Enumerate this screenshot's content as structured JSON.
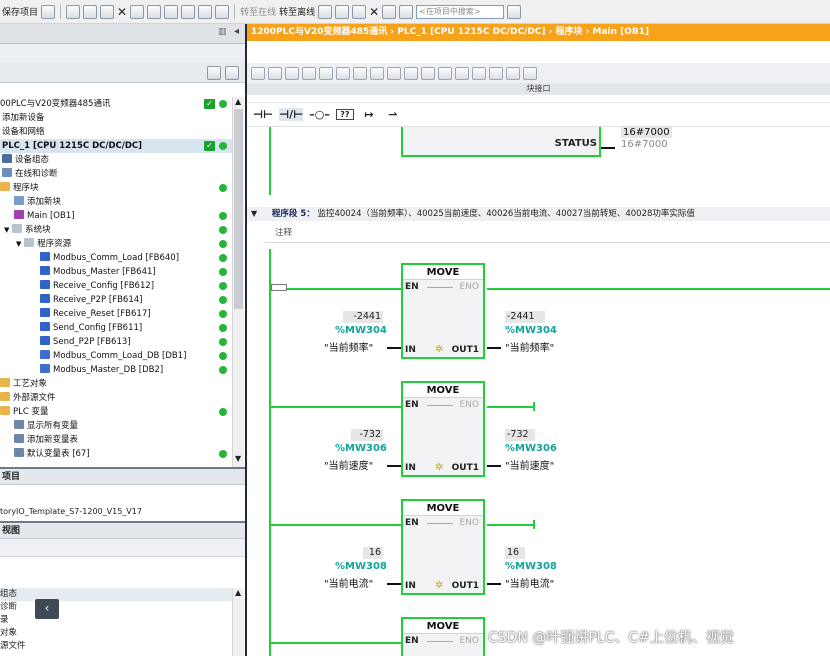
{
  "toolbar": {
    "save_project": "保存项目",
    "go_online": "转至在线",
    "go_offline": "转至离线",
    "search_placeholder": "<在项目中搜索>"
  },
  "project_tree": {
    "items": [
      {
        "label": "00PLC与V20变频器485通讯",
        "status": "check+dot"
      },
      {
        "label": "添加新设备"
      },
      {
        "label": "设备和网络"
      },
      {
        "label": "PLC_1 [CPU 1215C DC/DC/DC]",
        "status": "check+dot",
        "selected": true
      },
      {
        "label": "设备组态",
        "icon": "device-config-icon"
      },
      {
        "label": "在线和诊断",
        "icon": "diagnostics-icon"
      },
      {
        "label": "程序块",
        "icon": "folder-icon",
        "status": "dot"
      },
      {
        "label": "添加新块",
        "icon": "add-block-icon"
      },
      {
        "label": "Main [OB1]",
        "icon": "ob-icon",
        "status": "dot"
      },
      {
        "label": "系统块",
        "icon": "folder-icon",
        "status": "dot"
      },
      {
        "label": "程序资源",
        "icon": "folder-icon",
        "status": "dot"
      },
      {
        "label": "Modbus_Comm_Load [FB640]",
        "icon": "fb-icon",
        "status": "dot"
      },
      {
        "label": "Modbus_Master [FB641]",
        "icon": "fb-icon",
        "status": "dot"
      },
      {
        "label": "Receive_Config [FB612]",
        "icon": "fb-icon",
        "status": "dot"
      },
      {
        "label": "Receive_P2P [FB614]",
        "icon": "fb-icon",
        "status": "dot"
      },
      {
        "label": "Receive_Reset [FB617]",
        "icon": "fb-icon",
        "status": "dot"
      },
      {
        "label": "Send_Config [FB611]",
        "icon": "fb-icon",
        "status": "dot"
      },
      {
        "label": "Send_P2P [FB613]",
        "icon": "fb-icon",
        "status": "dot"
      },
      {
        "label": "Modbus_Comm_Load_DB [DB1]",
        "icon": "db-icon",
        "status": "dot"
      },
      {
        "label": "Modbus_Master_DB [DB2]",
        "icon": "db-icon",
        "status": "dot"
      },
      {
        "label": "工艺对象",
        "icon": "folder-icon"
      },
      {
        "label": "外部源文件",
        "icon": "folder-icon"
      },
      {
        "label": "PLC 变量",
        "icon": "folder-icon",
        "status": "dot"
      },
      {
        "label": "显示所有变量",
        "icon": "tag-icon"
      },
      {
        "label": "添加新变量表",
        "icon": "tag-icon"
      },
      {
        "label": "默认变量表 [67]",
        "icon": "tag-icon",
        "status": "dot"
      }
    ]
  },
  "details": {
    "header": "项目",
    "file": "toryIO_Template_S7-1200_V15_V17"
  },
  "overview": {
    "header": "视图",
    "items": [
      "组态",
      "诊断",
      "录",
      "对象",
      "源文件"
    ]
  },
  "editor": {
    "breadcrumb": "1200PLC与V20变频器485通讯  ›  PLC_1 [CPU 1215C DC/DC/DC]  ›  程序块  ›  Main [OB1]",
    "block_interface": "块接口",
    "ladder_toolbar": [
      "⊣⊢",
      "⊣/⊢",
      "–○–",
      "??",
      "↦",
      "⇀"
    ],
    "prev_status_label": "STATUS",
    "prev_status_value": "16#7000",
    "prev_status_value2": "16#7000",
    "network5": {
      "label": "程序段 5：",
      "title": "监控40024（当前频率）、40025当前速度、40026当前电流、40027当前转矩、40028功率实际值",
      "comment": "注释"
    },
    "blocks": [
      {
        "name": "MOVE",
        "en": "EN",
        "eno": "ENO",
        "in": "IN",
        "out": "OUT1",
        "in_val": "-2441",
        "in_addr": "%MW304",
        "in_sym": "\"当前频率\"",
        "out_val": "-2441",
        "out_addr": "%MW304",
        "out_sym": "\"当前频率\""
      },
      {
        "name": "MOVE",
        "en": "EN",
        "eno": "ENO",
        "in": "IN",
        "out": "OUT1",
        "in_val": "-732",
        "in_addr": "%MW306",
        "in_sym": "\"当前速度\"",
        "out_val": "-732",
        "out_addr": "%MW306",
        "out_sym": "\"当前速度\""
      },
      {
        "name": "MOVE",
        "en": "EN",
        "eno": "ENO",
        "in": "IN",
        "out": "OUT1",
        "in_val": "16",
        "in_addr": "%MW308",
        "in_sym": "\"当前电流\"",
        "out_val": "16",
        "out_addr": "%MW308",
        "out_sym": "\"当前电流\""
      },
      {
        "name": "MOVE",
        "en": "EN",
        "eno": "ENO"
      }
    ]
  },
  "watermark": "CSDN @叶强讲PLC、C#上位机、视觉",
  "colors": {
    "breadcrumb_bg": "#f7a21b",
    "power_flow": "#1fd03a",
    "address": "#12a39a",
    "status_ok": "#27b43a"
  }
}
